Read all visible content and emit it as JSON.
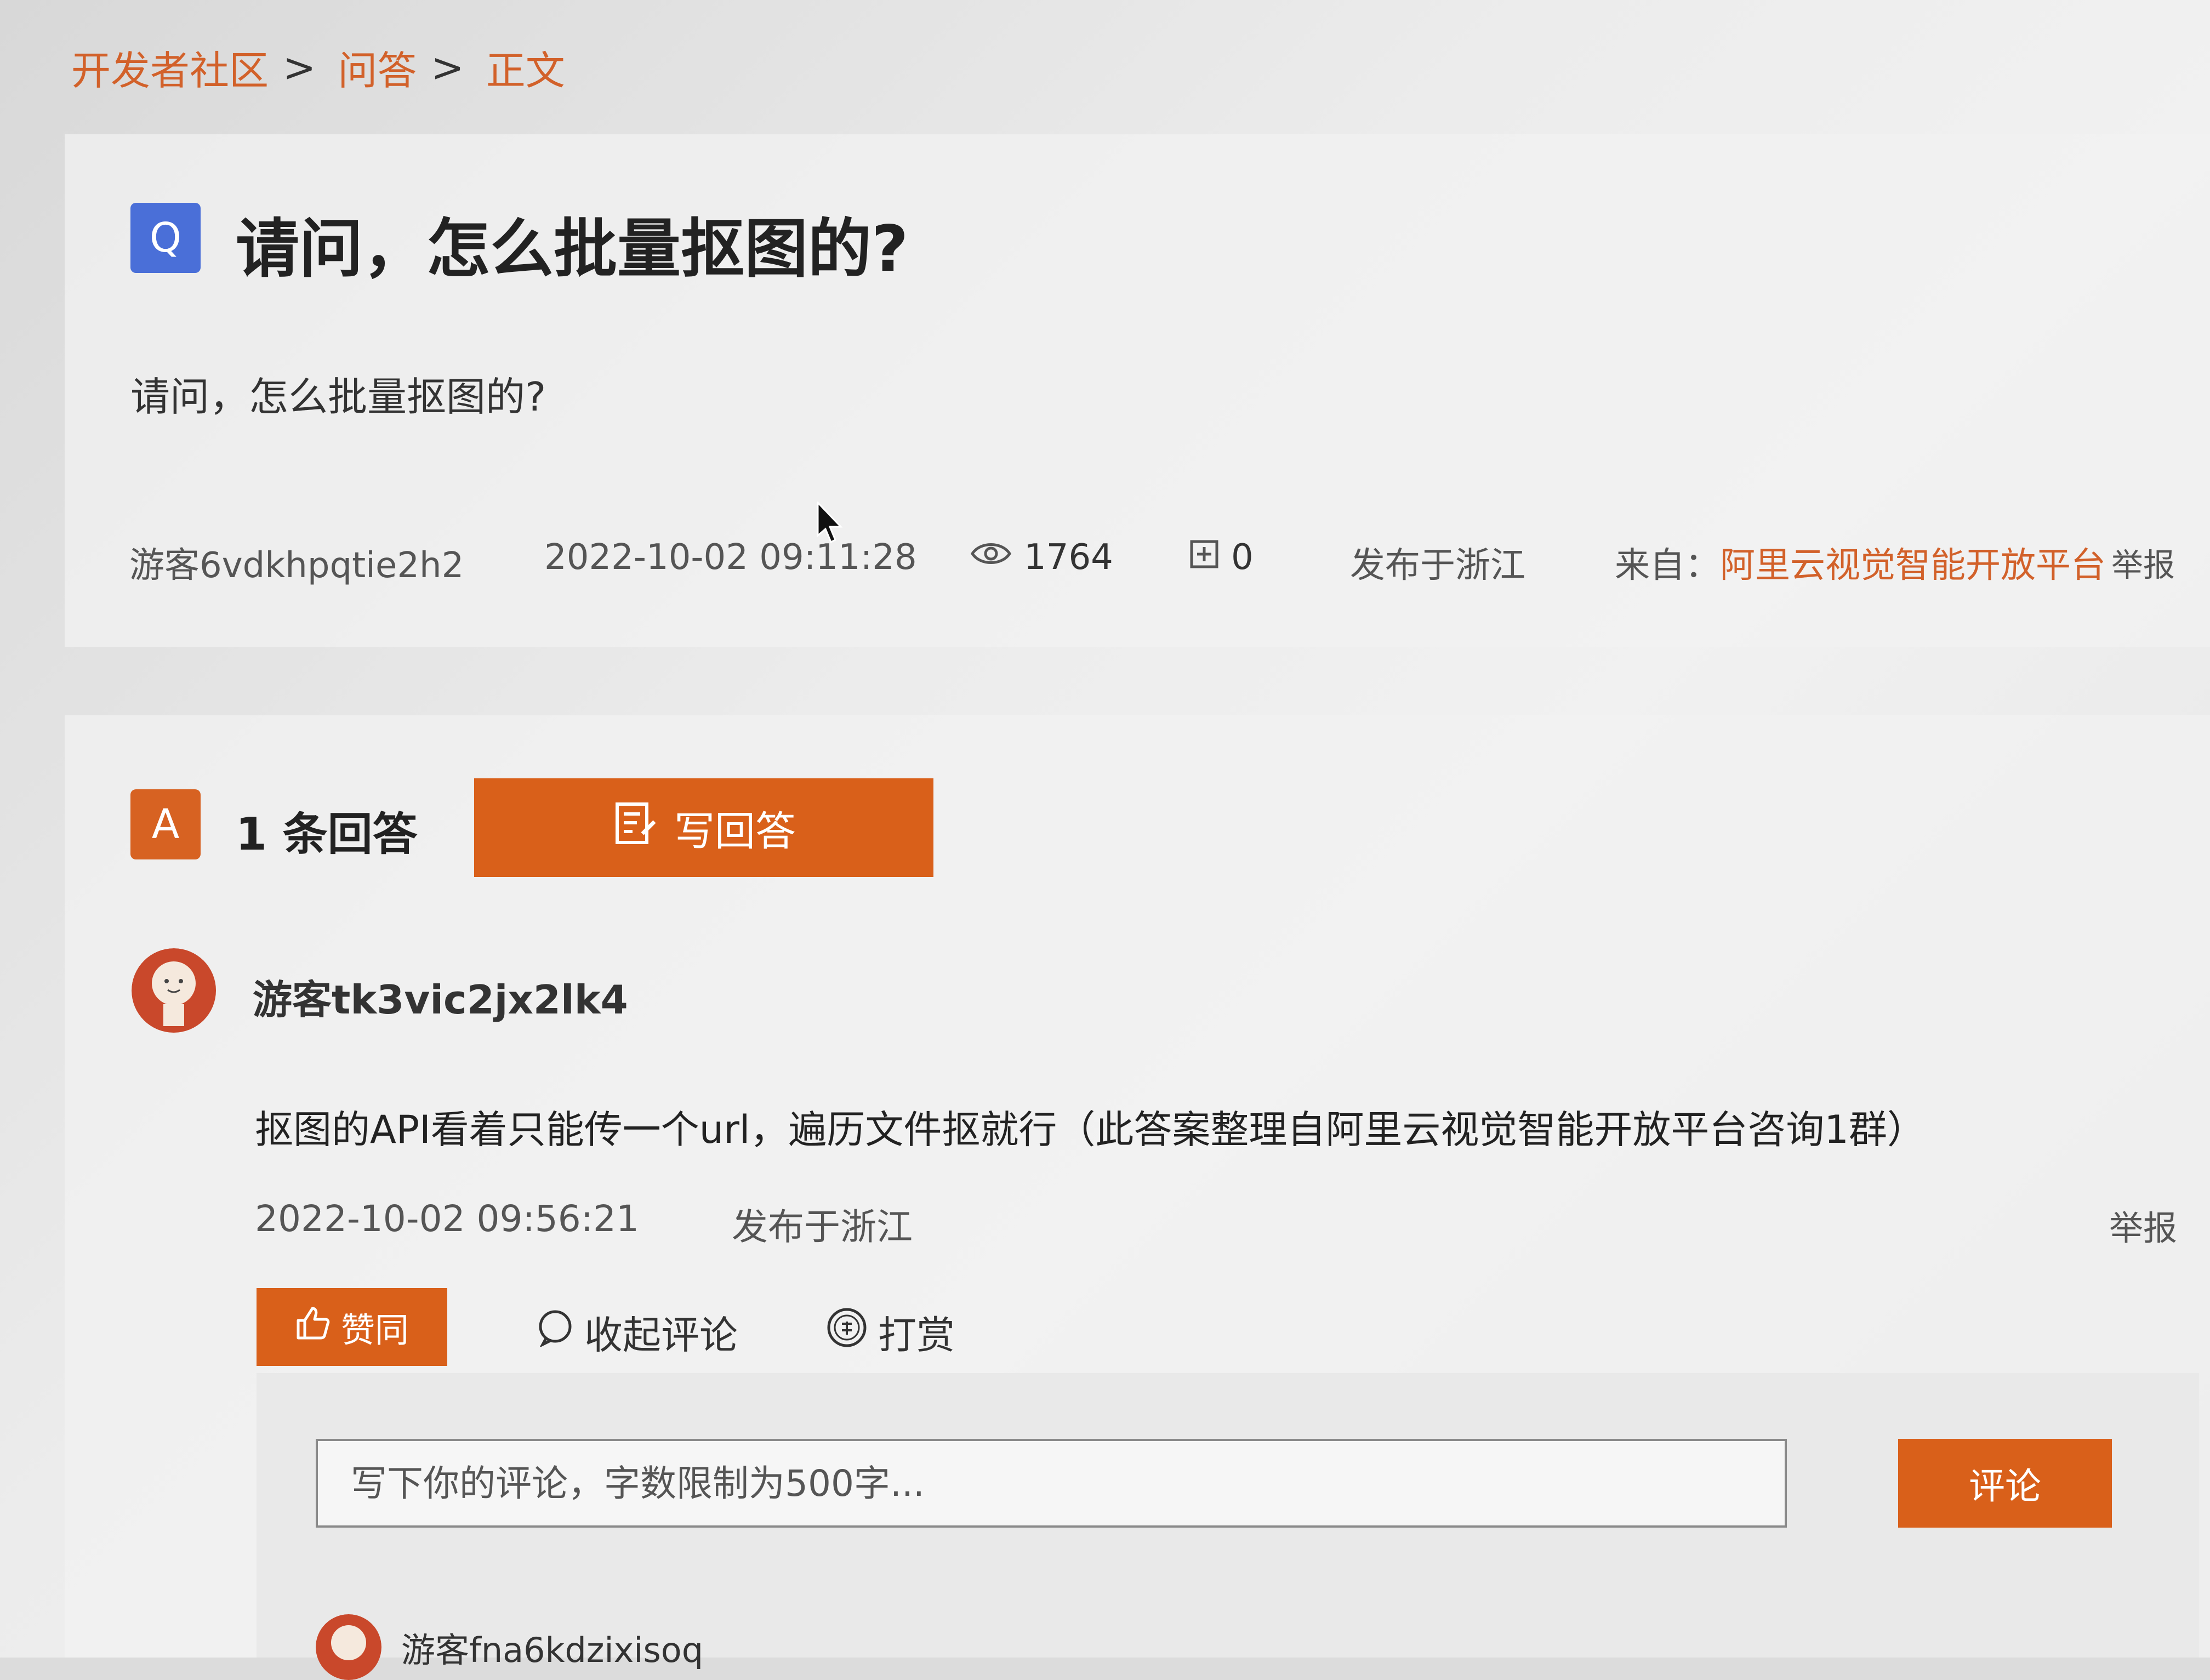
{
  "breadcrumb": {
    "items": [
      "开发者社区",
      "问答",
      "正文"
    ],
    "separator": ">"
  },
  "question": {
    "badge": "Q",
    "title": "请问，怎么批量抠图的?",
    "body": "请问，怎么批量抠图的?",
    "author": "游客6vdkhpqtie2h2",
    "datetime": "2022-10-02 09:11:28",
    "views": "1764",
    "favorites": "0",
    "location": "发布于浙江",
    "source_label": "来自：",
    "source_link": "阿里云视觉智能开放平台",
    "report": "举报"
  },
  "answers_section": {
    "badge": "A",
    "count_label": "1 条回答",
    "write_button": "写回答"
  },
  "answer": {
    "user": "游客tk3vic2jx2lk4",
    "text": "抠图的API看着只能传一个url，遍历文件抠就行（此答案整理自阿里云视觉智能开放平台咨询1群）",
    "datetime": "2022-10-02 09:56:21",
    "location": "发布于浙江",
    "report": "举报",
    "like_button": "赞同",
    "collapse_comments": "收起评论",
    "tip": "打赏"
  },
  "comment_box": {
    "placeholder": "写下你的评论，字数限制为500字...",
    "submit_button": "评论"
  },
  "sub_comment": {
    "user": "游客fna6kdzixisoq"
  },
  "colors": {
    "accent": "#d9601a",
    "q_badge": "#4a6fd8",
    "link": "#d2612a"
  }
}
